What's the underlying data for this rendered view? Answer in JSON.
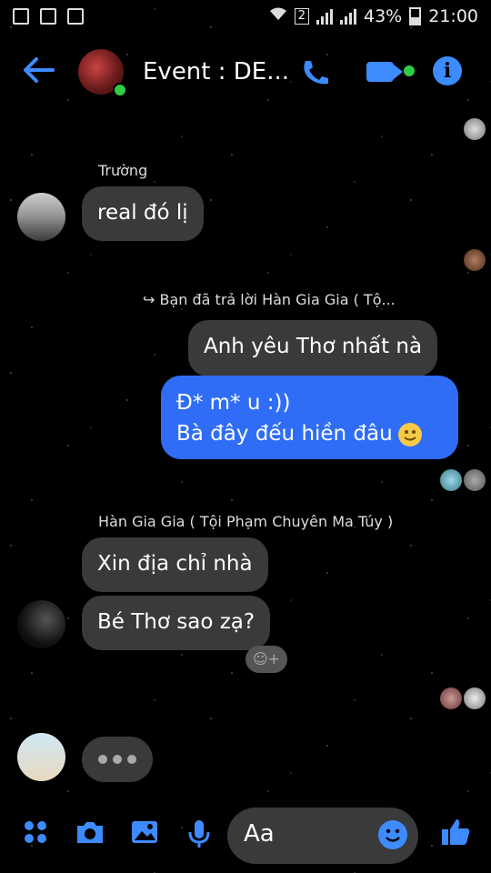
{
  "status": {
    "battery": "43%",
    "time": "21:00",
    "sim": "2"
  },
  "header": {
    "title": "Event : DE..."
  },
  "messages": {
    "m1": {
      "sender": "Trường",
      "text": "real đó lị"
    },
    "reply_note": "Bạn đã trả lời Hàn Gia Gia ( Tộ...",
    "m2": {
      "text": "Anh yêu Thơ nhất nà"
    },
    "m3": {
      "line1": "Đ* m* u :))",
      "line2": "Bà đây đếu hiền đâu"
    },
    "m4": {
      "sender": "Hàn Gia Gia ( Tội Phạm Chuyên Ma Túy )",
      "text1": "Xin địa chỉ nhà",
      "text2": "Bé Thơ sao zạ?"
    }
  },
  "composer": {
    "placeholder": "Aa"
  },
  "colors": {
    "accent": "#3d8bff",
    "outgoing": "#2f6df6",
    "incoming": "#3a3a3c",
    "online": "#31cc46"
  },
  "icons": [
    "back-arrow-icon",
    "phone-icon",
    "video-icon",
    "info-icon",
    "apps-icon",
    "camera-icon",
    "gallery-icon",
    "mic-icon",
    "emoji-icon",
    "like-icon"
  ]
}
